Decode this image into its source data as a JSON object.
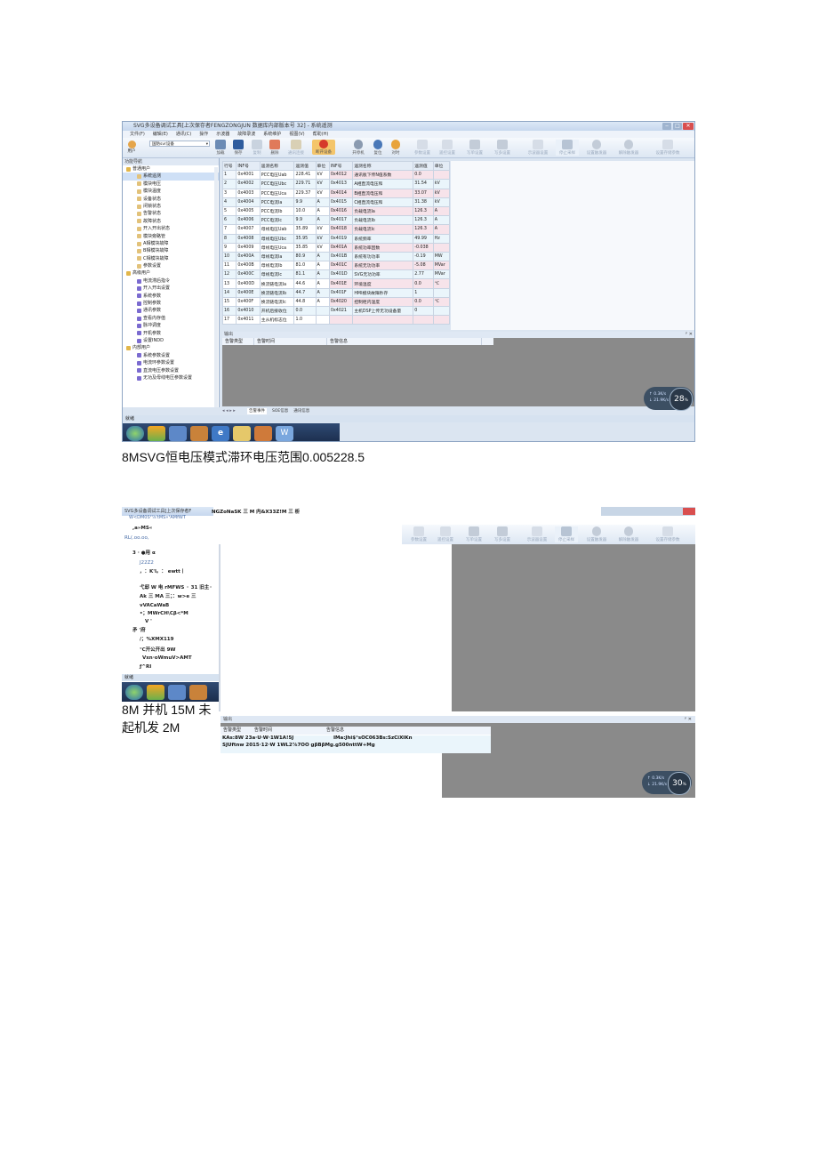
{
  "win1": {
    "title": "SVG多设备调试工具[上次保存者FENGZONGJUN 数据库内部版本号 32] - 系统遥测",
    "menu": [
      "文件(F)",
      "编辑(E)",
      "通讯(C)",
      "操作",
      "示波器",
      "故障录波",
      "系统维护",
      "视图(V)",
      "帮助(H)"
    ],
    "device_select": "国防svr设备",
    "user_label": "用户",
    "toolbar": [
      "加载",
      "保存",
      "复制",
      "删除",
      "通讯连接",
      "断开设备",
      "开停机",
      "复位",
      "对时",
      "参数设置",
      "遥控设置",
      "写单设置",
      "写多设置",
      "示波器设置",
      "停止采样",
      "设置触发器",
      "解除触发器",
      "设置存储参数"
    ],
    "nav_title": "功能导航",
    "nav_items": [
      {
        "label": "普通用户",
        "level": 0
      },
      {
        "label": "系统遥测",
        "level": 1
      },
      {
        "label": "模块电压",
        "level": 1
      },
      {
        "label": "模块温度",
        "level": 1
      },
      {
        "label": "设备状态",
        "level": 1
      },
      {
        "label": "闭锁状态",
        "level": 1
      },
      {
        "label": "告警状态",
        "level": 1
      },
      {
        "label": "故障状态",
        "level": 1
      },
      {
        "label": "开入开出状态",
        "level": 1
      },
      {
        "label": "模块旁路管",
        "level": 1
      },
      {
        "label": "A相模块故障",
        "level": 1
      },
      {
        "label": "B相模块故障",
        "level": 1
      },
      {
        "label": "C相模块故障",
        "level": 1
      },
      {
        "label": "参数设置",
        "level": 1
      },
      {
        "label": "高级用户",
        "level": 0
      },
      {
        "label": "电流滞后指令",
        "level": 1
      },
      {
        "label": "开入开出设置",
        "level": 1
      },
      {
        "label": "系统参数",
        "level": 1
      },
      {
        "label": "控制参数",
        "level": 1
      },
      {
        "label": "通讯参数",
        "level": 1
      },
      {
        "label": "查看内存值",
        "level": 1
      },
      {
        "label": "脉冲调度",
        "level": 1
      },
      {
        "label": "开机参数",
        "level": 1
      },
      {
        "label": "设置INDD",
        "level": 1
      },
      {
        "label": "内部用户",
        "level": 0
      },
      {
        "label": "系统参数设置",
        "level": 1
      },
      {
        "label": "电流环参数设置",
        "level": 1
      },
      {
        "label": "直流电压参数设置",
        "level": 1
      },
      {
        "label": "无功及母线电压参数设置",
        "level": 1
      }
    ],
    "table": {
      "headers": [
        "行号",
        "INF号",
        "遥测名称",
        "遥测值",
        "单位",
        "INF号",
        "遥测名称",
        "遥测值",
        "单位"
      ],
      "rows": [
        [
          "1",
          "0x4001",
          "PCC电压Uab",
          "228.41",
          "kV",
          "0x4012",
          "通讯板下传N值系数",
          "0.0",
          ""
        ],
        [
          "2",
          "0x4002",
          "PCC电压Ubc",
          "229.71",
          "kV",
          "0x4013",
          "A相直流电压和",
          "31.54",
          "kV"
        ],
        [
          "3",
          "0x4003",
          "PCC电压Uca",
          "229.37",
          "kV",
          "0x4014",
          "B相直流电压和",
          "33.07",
          "kV"
        ],
        [
          "4",
          "0x4004",
          "PCC电流Ia",
          "9.9",
          "A",
          "0x4015",
          "C相直流电压和",
          "31.38",
          "kV"
        ],
        [
          "5",
          "0x4005",
          "PCC电流Ib",
          "10.0",
          "A",
          "0x4016",
          "负载电流Ia",
          "126.3",
          "A"
        ],
        [
          "6",
          "0x4006",
          "PCC电流Ic",
          "9.9",
          "A",
          "0x4017",
          "负载电流Ib",
          "126.3",
          "A"
        ],
        [
          "7",
          "0x4007",
          "母线电压Uab",
          "35.89",
          "kV",
          "0x4018",
          "负载电流Ic",
          "126.3",
          "A"
        ],
        [
          "8",
          "0x4008",
          "母线电压Ubc",
          "35.95",
          "kV",
          "0x4019",
          "系统频率",
          "49.99",
          "Hz"
        ],
        [
          "9",
          "0x4009",
          "母线电压Uca",
          "35.85",
          "kV",
          "0x401A",
          "系统功率因数",
          "-0.038",
          ""
        ],
        [
          "10",
          "0x400A",
          "母线电流Ia",
          "80.9",
          "A",
          "0x401B",
          "系统有功功率",
          "-0.19",
          "MW"
        ],
        [
          "11",
          "0x400B",
          "母线电流Ib",
          "81.0",
          "A",
          "0x401C",
          "系统无功功率",
          "-5.08",
          "MVar"
        ],
        [
          "12",
          "0x400C",
          "母线电流Ic",
          "81.1",
          "A",
          "0x401D",
          "SVG无功功率",
          "2.77",
          "MVar"
        ],
        [
          "13",
          "0x400D",
          "换流链电流Ia",
          "44.6",
          "A",
          "0x401E",
          "环境温度",
          "0.0",
          "℃"
        ],
        [
          "14",
          "0x400E",
          "换流链电流Ib",
          "44.7",
          "A",
          "0x401F",
          "HMI模块故障秒存",
          "1",
          ""
        ],
        [
          "15",
          "0x400F",
          "换流链电流Ic",
          "44.8",
          "A",
          "0x4020",
          "控制柜内温度",
          "0.0",
          "℃"
        ],
        [
          "16",
          "0x4010",
          "开机后接收位",
          "0.0",
          "",
          "0x4021",
          "主机DSP上传无功设备量",
          "0",
          ""
        ],
        [
          "17",
          "0x4011",
          "主从机标志位",
          "1.0",
          "",
          "",
          "",
          "",
          ""
        ]
      ]
    },
    "output_title": "输出",
    "output_cols": [
      "告警类型",
      "告警时间",
      "告警信息"
    ],
    "bottom_tabs": [
      "告警事件",
      "SOE信息",
      "通讯信息"
    ],
    "status_text": "就绪",
    "gauge": {
      "line1": "↑ 0.3K/s",
      "line2": "↓ 21.9K/s",
      "value": "28",
      "unit": "%"
    }
  },
  "caption1": "8MSVG恒电压模式滞环电压范围0.005228.5",
  "win2": {
    "title_prefix": "SVG多设备调试工具[上次保存者F",
    "title_rest": "NGZoNaSK 三 M 内&X33Z!M 三 析",
    "subtitle": "W<DM0S²⅞'tMS»¹AMfWT",
    "nav_lines": [
      ",a»MS«",
      "RL(.oo.oo,",
      "3 · ●用 α",
      "J22Z2",
      "，：K'l。： ewtt丨",
      "弋邸 W 电 rMFWS ◦ 31 旧主◦",
      "Ak 三 MA 三；：w>e 三",
      "vVACaWaB",
      "•；MWrCH\\Cβ<*M",
      "V '",
      "矛 '府",
      "/；%XMX119",
      "℃开公开出 9W",
      "Vxn·oWmuV>AMT",
      "ƒ^RI"
    ],
    "status_text": "就绪",
    "output_title": "输出",
    "output_cols": [
      "告警类型",
      "告警时间",
      "告警信息"
    ],
    "row1_left": "KAs:8W 23a·U·W·1W1A!5J",
    "row1_right": "IMa:Jhi$°sOC063Bs:SzCiXIKn",
    "row2": "SJUftnw 2015·12·W 1WL2⅞7OO gβBβMg.g500nttW+Mg",
    "gauge": {
      "line1": "↑ 0.3K/s",
      "line2": "↓ 21.9K/s",
      "value": "30",
      "unit": "%"
    }
  },
  "caption2": [
    "8M 并机 15M 未",
    "起机发 2M"
  ]
}
